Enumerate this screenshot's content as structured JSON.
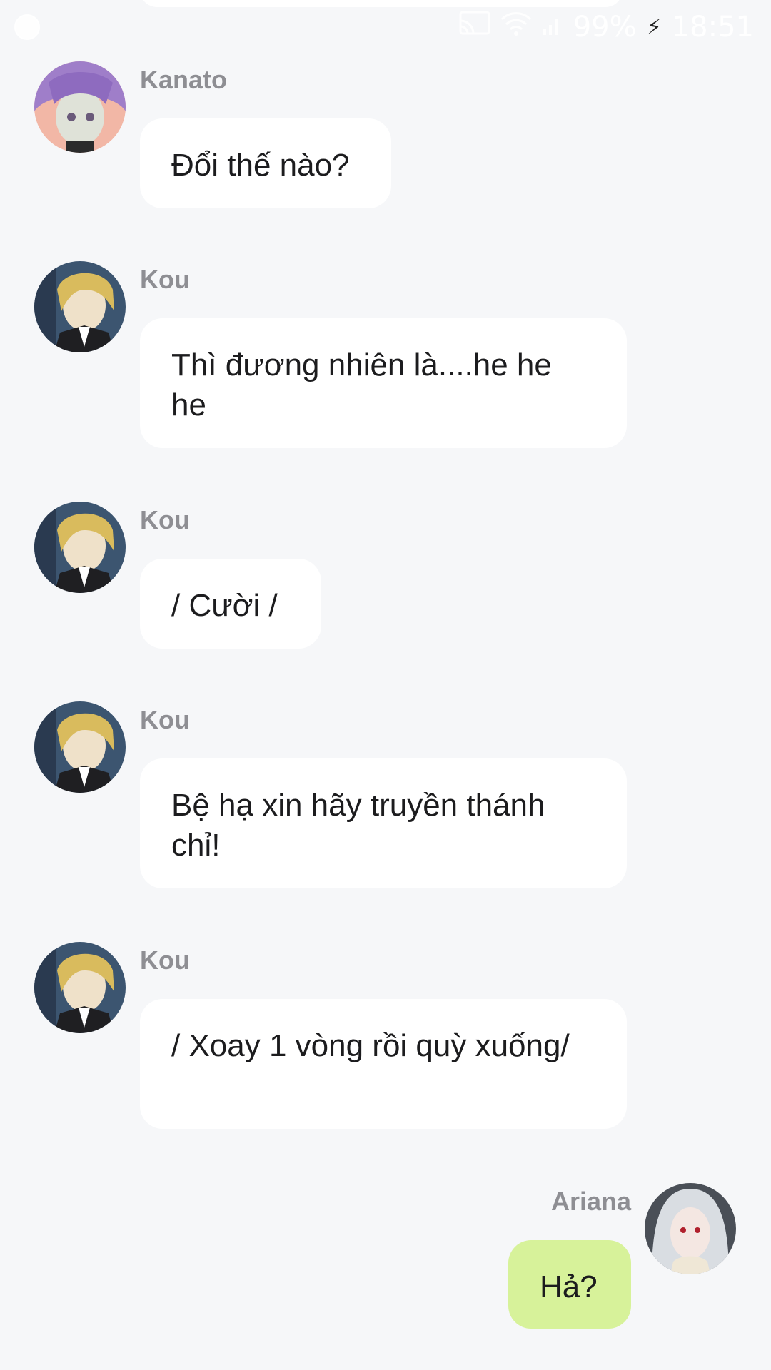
{
  "status_bar": {
    "battery": "99%",
    "time": "18:51",
    "icons": [
      "messenger-icon",
      "cast-icon",
      "wifi-icon",
      "signal-icon",
      "charging-icon"
    ]
  },
  "colors": {
    "background": "#f6f7f9",
    "bubble_incoming": "#ffffff",
    "bubble_outgoing": "#d7f29a",
    "sender_name": "#8e8e93"
  },
  "messages": [
    {
      "sender": "Kanato",
      "text": "Đổi thế nào?",
      "avatar": "kanato-avatar"
    },
    {
      "sender": "Kou",
      "text": "Thì đương nhiên là....he he he",
      "avatar": "kou-avatar"
    },
    {
      "sender": "Kou",
      "text": "/ Cười /",
      "avatar": "kou-avatar"
    },
    {
      "sender": "Kou",
      "text": "Bệ hạ xin hãy truyền thánh chỉ!",
      "avatar": "kou-avatar"
    },
    {
      "sender": "Kou",
      "text": "/ Xoay 1 vòng rồi quỳ xuống/",
      "avatar": "kou-avatar"
    },
    {
      "sender": "Ariana",
      "text": "Hả?",
      "avatar": "ariana-avatar"
    }
  ]
}
